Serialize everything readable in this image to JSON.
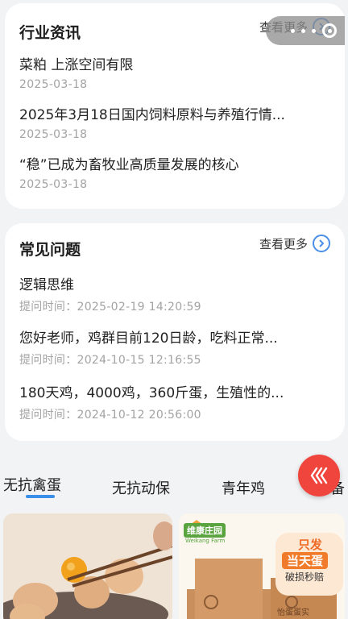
{
  "news": {
    "title": "行业资讯",
    "more_label": "查看更多",
    "items": [
      {
        "title": "菜粕 上涨空间有限",
        "date": "2025-03-18"
      },
      {
        "title": "2025年3月18日国内饲料原料与养殖行情...",
        "date": "2025-03-18"
      },
      {
        "title": "“稳”已成为畜牧业高质量发展的核心",
        "date": "2025-03-18"
      }
    ]
  },
  "faq": {
    "title": "常见问题",
    "more_label": "查看更多",
    "time_label": "提问时间：",
    "items": [
      {
        "title": "逻辑思维",
        "time": "2025-02-19 14:20:59"
      },
      {
        "title": "您好老师，鸡群目前120日龄，吃料正常...",
        "time": "2024-10-15 12:16:55"
      },
      {
        "title": "180天鸡，4000鸡，360斤蛋，生殖性的...",
        "time": "2024-10-12 20:56:00"
      }
    ]
  },
  "tabs": [
    "无抗禽蛋",
    "无抗动保",
    "青年鸡",
    "备"
  ],
  "products": [
    {
      "icon": "egg-yolk-photo"
    },
    {
      "brand": "维康庄园",
      "brand_en": "Weikang Farm",
      "promo_line1": "只发",
      "promo_line2": "当天蛋",
      "promo_line3": "破损秒赔",
      "box_label": "怡蛋蛋实"
    }
  ],
  "colors": {
    "accent": "#3b8fe8",
    "fab": "#f0453c"
  }
}
